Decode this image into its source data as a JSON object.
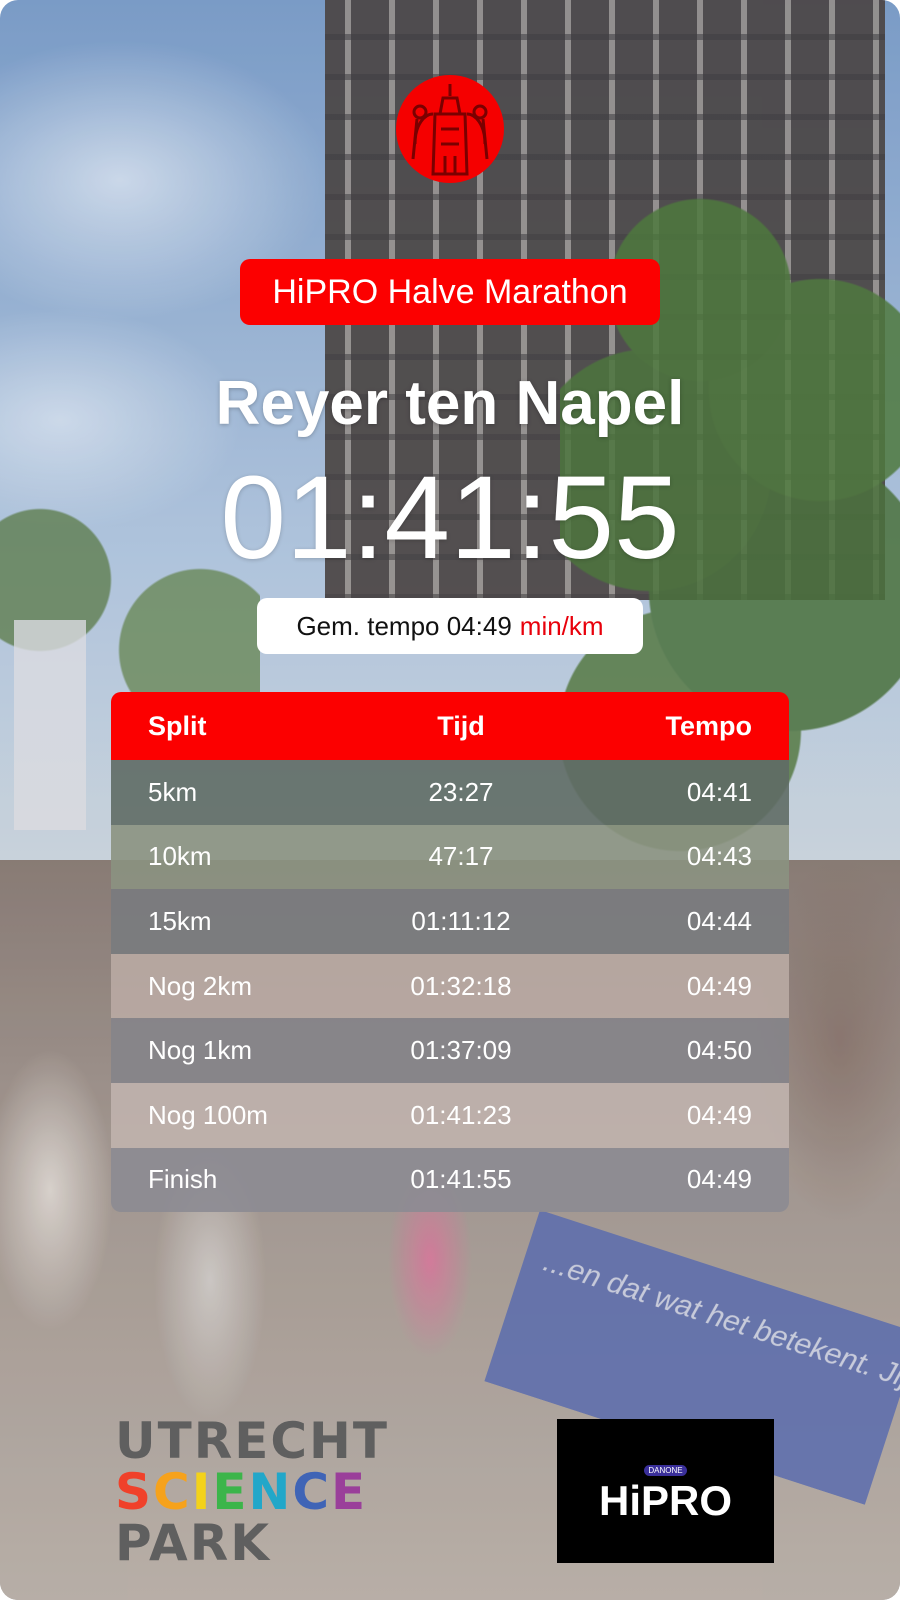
{
  "event": {
    "title": "HiPRO Halve Marathon",
    "runner_name": "Reyer ten Napel",
    "finish_time": "01:41:55",
    "avg_pace_label": "Gem. tempo 04:49",
    "avg_pace_unit": "min/km"
  },
  "splits": {
    "headers": [
      "Split",
      "Tijd",
      "Tempo"
    ],
    "rows": [
      {
        "split": "5km",
        "time": "23:27",
        "pace": "04:41"
      },
      {
        "split": "10km",
        "time": "47:17",
        "pace": "04:43"
      },
      {
        "split": "15km",
        "time": "01:11:12",
        "pace": "04:44"
      },
      {
        "split": "Nog 2km",
        "time": "01:32:18",
        "pace": "04:49"
      },
      {
        "split": "Nog 1km",
        "time": "01:37:09",
        "pace": "04:50"
      },
      {
        "split": "Nog 100m",
        "time": "01:41:23",
        "pace": "04:49"
      },
      {
        "split": "Finish",
        "time": "01:41:55",
        "pace": "04:49"
      }
    ],
    "row_colors": [
      "#5f6c65",
      "#8b9281",
      "#797b7e",
      "#b9aaa3",
      "#85848a",
      "#c0b2ad",
      "#8c8b92"
    ]
  },
  "sponsors": {
    "usp_line1": "UTRECHT",
    "usp_line2": "SCIENCE",
    "usp_line3": "PARK",
    "usp_colors": [
      "#f0412a",
      "#f6a21c",
      "#f3d21a",
      "#3cb54a",
      "#22a7c9",
      "#3f64b6",
      "#9a3f9a"
    ],
    "hipro_small": "DANONE",
    "hipro_name": "HiPRO"
  },
  "background": {
    "fence_text": "...en dat wat het betekent. Jij als donor het verschil te maken."
  },
  "colors": {
    "accent_red": "#fc0000",
    "unit_red": "#e8000b"
  }
}
